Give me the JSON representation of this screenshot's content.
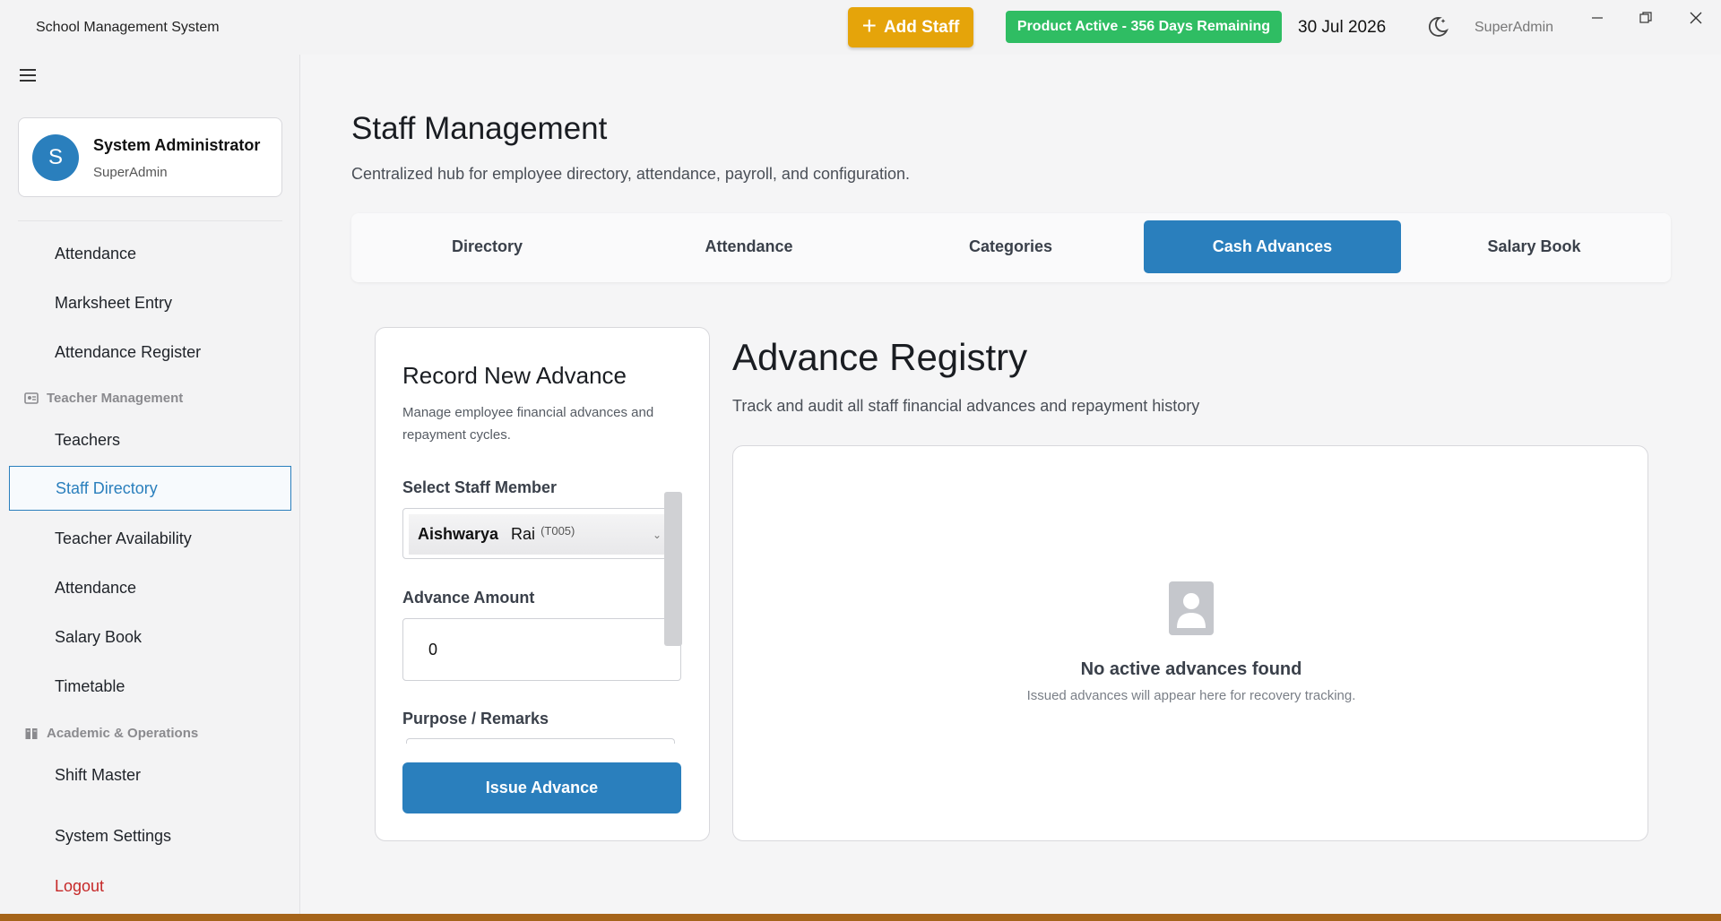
{
  "app": {
    "title": "School Management System"
  },
  "header": {
    "add_staff_label": "Add Staff",
    "license_text": "Product Active - 356 Days Remaining",
    "date": "30 Jul 2026",
    "user": "SuperAdmin",
    "theme_icon": "moon-icon"
  },
  "sidebar": {
    "profile": {
      "initial": "S",
      "name": "System Administrator",
      "role": "SuperAdmin"
    },
    "items": [
      {
        "label": "Attendance"
      },
      {
        "label": "Marksheet Entry"
      },
      {
        "label": "Attendance Register"
      },
      {
        "label": "Teachers"
      },
      {
        "label": "Staff Directory",
        "active": true
      },
      {
        "label": "Teacher Availability"
      },
      {
        "label": "Attendance"
      },
      {
        "label": "Salary Book"
      },
      {
        "label": "Timetable"
      },
      {
        "label": "Shift Master"
      },
      {
        "label": "System Settings"
      },
      {
        "label": "Logout"
      }
    ],
    "sections": [
      {
        "label": "Teacher Management",
        "icon": "teacher-icon"
      },
      {
        "label": "Academic & Operations",
        "icon": "book-icon"
      }
    ]
  },
  "page": {
    "title": "Staff Management",
    "subtitle": "Centralized hub for employee directory, attendance, payroll, and configuration."
  },
  "tabs": [
    {
      "label": "Directory"
    },
    {
      "label": "Attendance"
    },
    {
      "label": "Categories"
    },
    {
      "label": "Cash Advances",
      "active": true
    },
    {
      "label": "Salary Book"
    }
  ],
  "record": {
    "title": "Record New Advance",
    "description": "Manage employee financial advances and repayment cycles.",
    "staff_label": "Select Staff Member",
    "staff_first": "Aishwarya",
    "staff_last": "Rai",
    "staff_code": "(T005)",
    "amount_label": "Advance Amount",
    "amount_value": "0",
    "remarks_label": "Purpose / Remarks",
    "issue_label": "Issue Advance"
  },
  "registry": {
    "title": "Advance Registry",
    "subtitle": "Track and audit all staff financial advances and repayment history",
    "empty_title": "No active advances found",
    "empty_desc": "Issued advances will appear here for recovery tracking."
  },
  "colors": {
    "accent": "#2a7fbd",
    "add_staff": "#e5a40a",
    "license": "#2fbd63",
    "logout": "#c62828"
  }
}
